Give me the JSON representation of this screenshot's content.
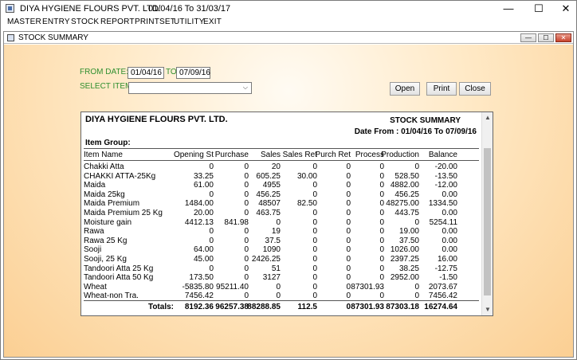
{
  "app": {
    "title": "DIYA HYGIENE FLOURS PVT. LTD.",
    "period": "01/04/16 To 31/03/17",
    "min_glyph": "—",
    "max_glyph": "☐",
    "close_glyph": "✕"
  },
  "menu": [
    "MASTER",
    "ENTRY",
    "STOCK",
    "REPORT",
    "PRINTSET",
    "UTILITY",
    "EXIT"
  ],
  "child_window": {
    "title": "STOCK SUMMARY"
  },
  "form": {
    "from_date_label": "FROM DATE:",
    "from_date": "01/04/16",
    "to_label": "TO",
    "to_date": "07/09/16",
    "select_item_label": "SELECT ITEM:",
    "select_item_value": "",
    "buttons": {
      "open": "Open",
      "print": "Print",
      "close": "Close"
    }
  },
  "report": {
    "company": "DIYA HYGIENE FLOURS PVT. LTD.",
    "title": "STOCK SUMMARY",
    "date_range": "Date From : 01/04/16 To 07/09/16",
    "item_group_label": "Item Group:",
    "columns": [
      "Item Name",
      "Opening St",
      "Purchase",
      "Sales",
      "Sales Ret",
      "Purch Ret",
      "Process",
      "Production",
      "Balance"
    ],
    "rows": [
      [
        "Chakki Atta",
        "0",
        "0",
        "20",
        "0",
        "0",
        "0",
        "0",
        "-20.00"
      ],
      [
        "CHAKKI ATTA-25Kg",
        "33.25",
        "0",
        "605.25",
        "30.00",
        "0",
        "0",
        "528.50",
        "-13.50"
      ],
      [
        "Maida",
        "61.00",
        "0",
        "4955",
        "0",
        "0",
        "0",
        "4882.00",
        "-12.00"
      ],
      [
        "Maida 25kg",
        "0",
        "0",
        "456.25",
        "0",
        "0",
        "0",
        "456.25",
        "0.00"
      ],
      [
        "Maida Premium",
        "1484.00",
        "0",
        "48507",
        "82.50",
        "0",
        "0",
        "48275.00",
        "1334.50"
      ],
      [
        "Maida Premium 25 Kg",
        "20.00",
        "0",
        "463.75",
        "0",
        "0",
        "0",
        "443.75",
        "0.00"
      ],
      [
        "Moisture  gain",
        "4412.13",
        "841.98",
        "0",
        "0",
        "0",
        "0",
        "0",
        "5254.11"
      ],
      [
        "Rawa",
        "0",
        "0",
        "19",
        "0",
        "0",
        "0",
        "19.00",
        "0.00"
      ],
      [
        "Rawa 25 Kg",
        "0",
        "0",
        "37.5",
        "0",
        "0",
        "0",
        "37.50",
        "0.00"
      ],
      [
        "Sooji",
        "64.00",
        "0",
        "1090",
        "0",
        "0",
        "0",
        "1026.00",
        "0.00"
      ],
      [
        "Sooji, 25 Kg",
        "45.00",
        "0",
        "2426.25",
        "0",
        "0",
        "0",
        "2397.25",
        "16.00"
      ],
      [
        "Tandoori  Atta 25 Kg",
        "0",
        "0",
        "51",
        "0",
        "0",
        "0",
        "38.25",
        "-12.75"
      ],
      [
        "Tandoori Atta 50 Kg",
        "173.50",
        "0",
        "3127",
        "0",
        "0",
        "0",
        "2952.00",
        "-1.50"
      ],
      [
        "Wheat",
        "-5835.80",
        "95211.40",
        "0",
        "0",
        "0",
        "87301.93",
        "0",
        "2073.67"
      ],
      [
        "Wheat-non Tra.",
        "7456.42",
        "0",
        "0",
        "0",
        "0",
        "0",
        "0",
        "7456.42"
      ]
    ],
    "totals_label": "Totals:",
    "totals": [
      "8192.36",
      "96257.38",
      "88288.85",
      "112.5",
      "0",
      "87301.93",
      "87303.18",
      "16274.64"
    ]
  },
  "colors": {
    "label_green": "#2f8f2f",
    "background_gradient_center": "#fffbf3",
    "background_gradient_edge": "#fbcf93"
  }
}
